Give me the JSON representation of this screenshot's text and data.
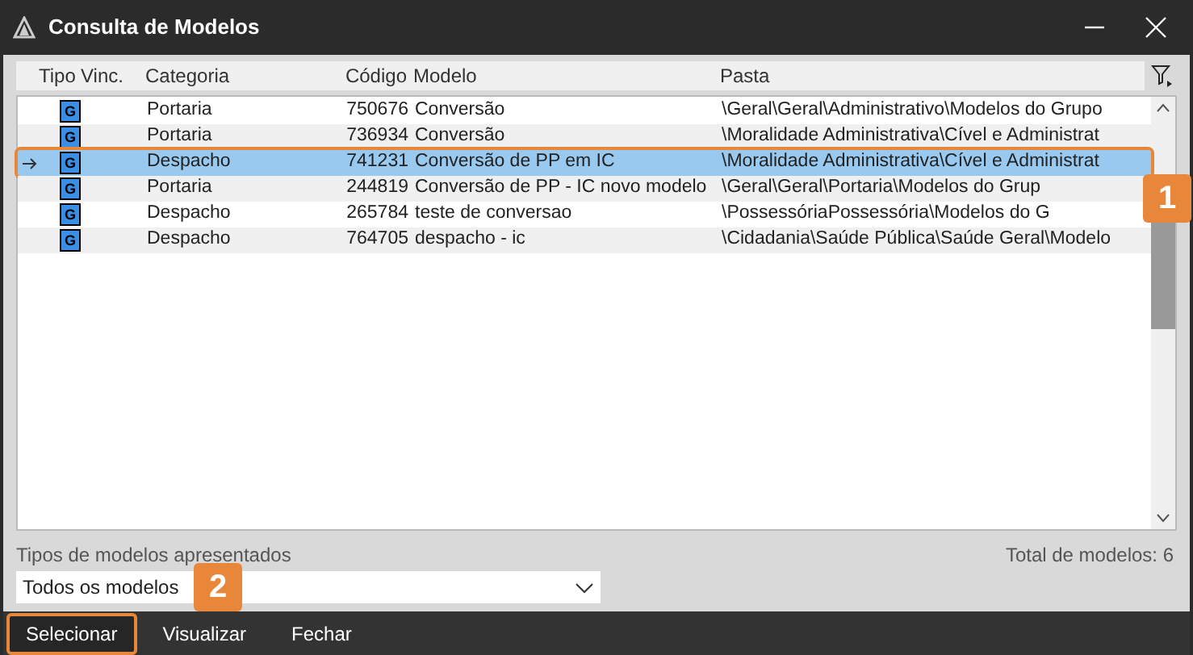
{
  "window": {
    "title": "Consulta de Modelos"
  },
  "table": {
    "columns": [
      "Tipo",
      "Vinc.",
      "Categoria",
      "Código",
      "Modelo",
      "Pasta"
    ],
    "rows": [
      {
        "selected": false,
        "tipo": "G",
        "categoria": "Portaria",
        "codigo": "750676",
        "modelo": "Conversão",
        "pasta": "\\Geral\\Geral\\Administrativo\\Modelos do Grupo"
      },
      {
        "selected": false,
        "tipo": "G",
        "categoria": "Portaria",
        "codigo": "736934",
        "modelo": "Conversão",
        "pasta": "\\Moralidade Administrativa\\Cível e Administrat"
      },
      {
        "selected": true,
        "tipo": "G",
        "categoria": "Despacho",
        "codigo": "741231",
        "modelo": "Conversão de PP em IC",
        "pasta": "\\Moralidade Administrativa\\Cível e Administrat"
      },
      {
        "selected": false,
        "tipo": "G",
        "categoria": "Portaria",
        "codigo": "244819",
        "modelo": "Conversão de PP - IC novo modelo",
        "pasta": "\\Geral\\Geral\\Portaria\\Modelos do Grup"
      },
      {
        "selected": false,
        "tipo": "G",
        "categoria": "Despacho",
        "codigo": "265784",
        "modelo": "teste de conversao",
        "pasta": "\\PossessóriaPossessória\\Modelos do G"
      },
      {
        "selected": false,
        "tipo": "G",
        "categoria": "Despacho",
        "codigo": "764705",
        "modelo": "despacho - ic",
        "pasta": "\\Cidadania\\Saúde Pública\\Saúde Geral\\Modelo"
      }
    ]
  },
  "filter": {
    "label": "Tipos de modelos apresentados",
    "value": "Todos os modelos"
  },
  "total": "Total de modelos: 6",
  "buttons": [
    {
      "label": "Selecionar",
      "highlighted": true
    },
    {
      "label": "Visualizar",
      "highlighted": false
    },
    {
      "label": "Fechar",
      "highlighted": false
    }
  ],
  "callouts": [
    "1",
    "2"
  ]
}
